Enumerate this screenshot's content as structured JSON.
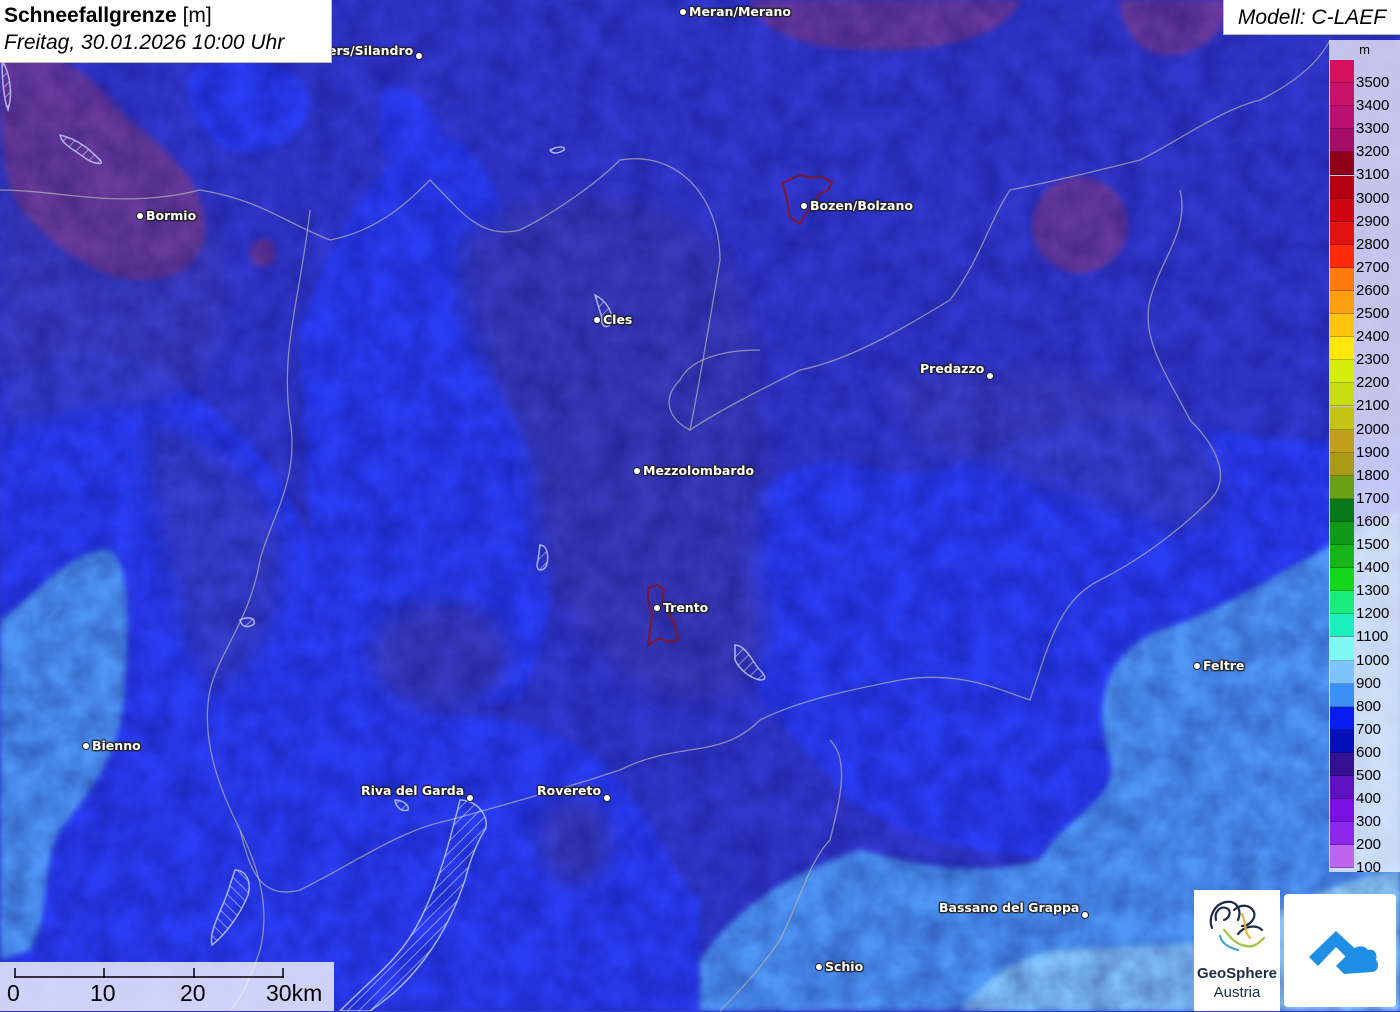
{
  "title": {
    "parameter": "Schneefallgrenze",
    "unit": "[m]",
    "datetime": "Freitag, 30.01.2026 10:00 Uhr"
  },
  "model": "Modell: C-LAEF",
  "legend": {
    "unit": "m",
    "entries": [
      {
        "label": "3500",
        "color": "#d5125e"
      },
      {
        "label": "3400",
        "color": "#c8126a"
      },
      {
        "label": "3300",
        "color": "#ba1070"
      },
      {
        "label": "3200",
        "color": "#a40d66"
      },
      {
        "label": "3100",
        "color": "#8f0019"
      },
      {
        "label": "3000",
        "color": "#b40012"
      },
      {
        "label": "2900",
        "color": "#cf0511"
      },
      {
        "label": "2800",
        "color": "#e1130f"
      },
      {
        "label": "2700",
        "color": "#fb2b0a"
      },
      {
        "label": "2600",
        "color": "#ff7a0d"
      },
      {
        "label": "2500",
        "color": "#ff9f0f"
      },
      {
        "label": "2400",
        "color": "#ffc40f"
      },
      {
        "label": "2300",
        "color": "#ffe70c"
      },
      {
        "label": "2200",
        "color": "#d4ef0c"
      },
      {
        "label": "2100",
        "color": "#c8de13"
      },
      {
        "label": "2000",
        "color": "#c5c314"
      },
      {
        "label": "1900",
        "color": "#c29f1a"
      },
      {
        "label": "1800",
        "color": "#a99a17"
      },
      {
        "label": "1700",
        "color": "#6aa114"
      },
      {
        "label": "1600",
        "color": "#08781b"
      },
      {
        "label": "1500",
        "color": "#119a1a"
      },
      {
        "label": "1400",
        "color": "#17b51a"
      },
      {
        "label": "1300",
        "color": "#12d71b"
      },
      {
        "label": "1200",
        "color": "#18ec7c"
      },
      {
        "label": "1100",
        "color": "#1bf0bd"
      },
      {
        "label": "1000",
        "color": "#7ef9f4"
      },
      {
        "label": "900",
        "color": "#80c2fa"
      },
      {
        "label": "800",
        "color": "#3a90f4"
      },
      {
        "label": "700",
        "color": "#0a1df1"
      },
      {
        "label": "600",
        "color": "#0610b8"
      },
      {
        "label": "500",
        "color": "#341092"
      },
      {
        "label": "400",
        "color": "#5f10c0"
      },
      {
        "label": "300",
        "color": "#7a11e0"
      },
      {
        "label": "200",
        "color": "#8d27ec"
      },
      {
        "label": "100",
        "color": "#bf64ee"
      }
    ]
  },
  "cities": [
    {
      "name": "Meran/Merano",
      "side": "right"
    },
    {
      "name": "ers/Silandro",
      "side": "left"
    },
    {
      "name": "Bormio",
      "side": "right"
    },
    {
      "name": "Bozen/Bolzano",
      "side": "right"
    },
    {
      "name": "Cles",
      "side": "right"
    },
    {
      "name": "Predazzo",
      "side": "left"
    },
    {
      "name": "Mezzolombardo",
      "side": "right"
    },
    {
      "name": "Trento",
      "side": "right"
    },
    {
      "name": "Feltre",
      "side": "right"
    },
    {
      "name": "Bienno",
      "side": "right"
    },
    {
      "name": "Riva del Garda",
      "side": "left"
    },
    {
      "name": "Rovereto",
      "side": "left"
    },
    {
      "name": "Bassano del Grappa",
      "side": "left"
    },
    {
      "name": "Schio",
      "side": "right"
    }
  ],
  "scalebar": {
    "labels": [
      "0",
      "10",
      "20",
      "30km"
    ]
  },
  "logos": {
    "geosphere_line1": "GeoSphere",
    "geosphere_line2": "Austria"
  }
}
